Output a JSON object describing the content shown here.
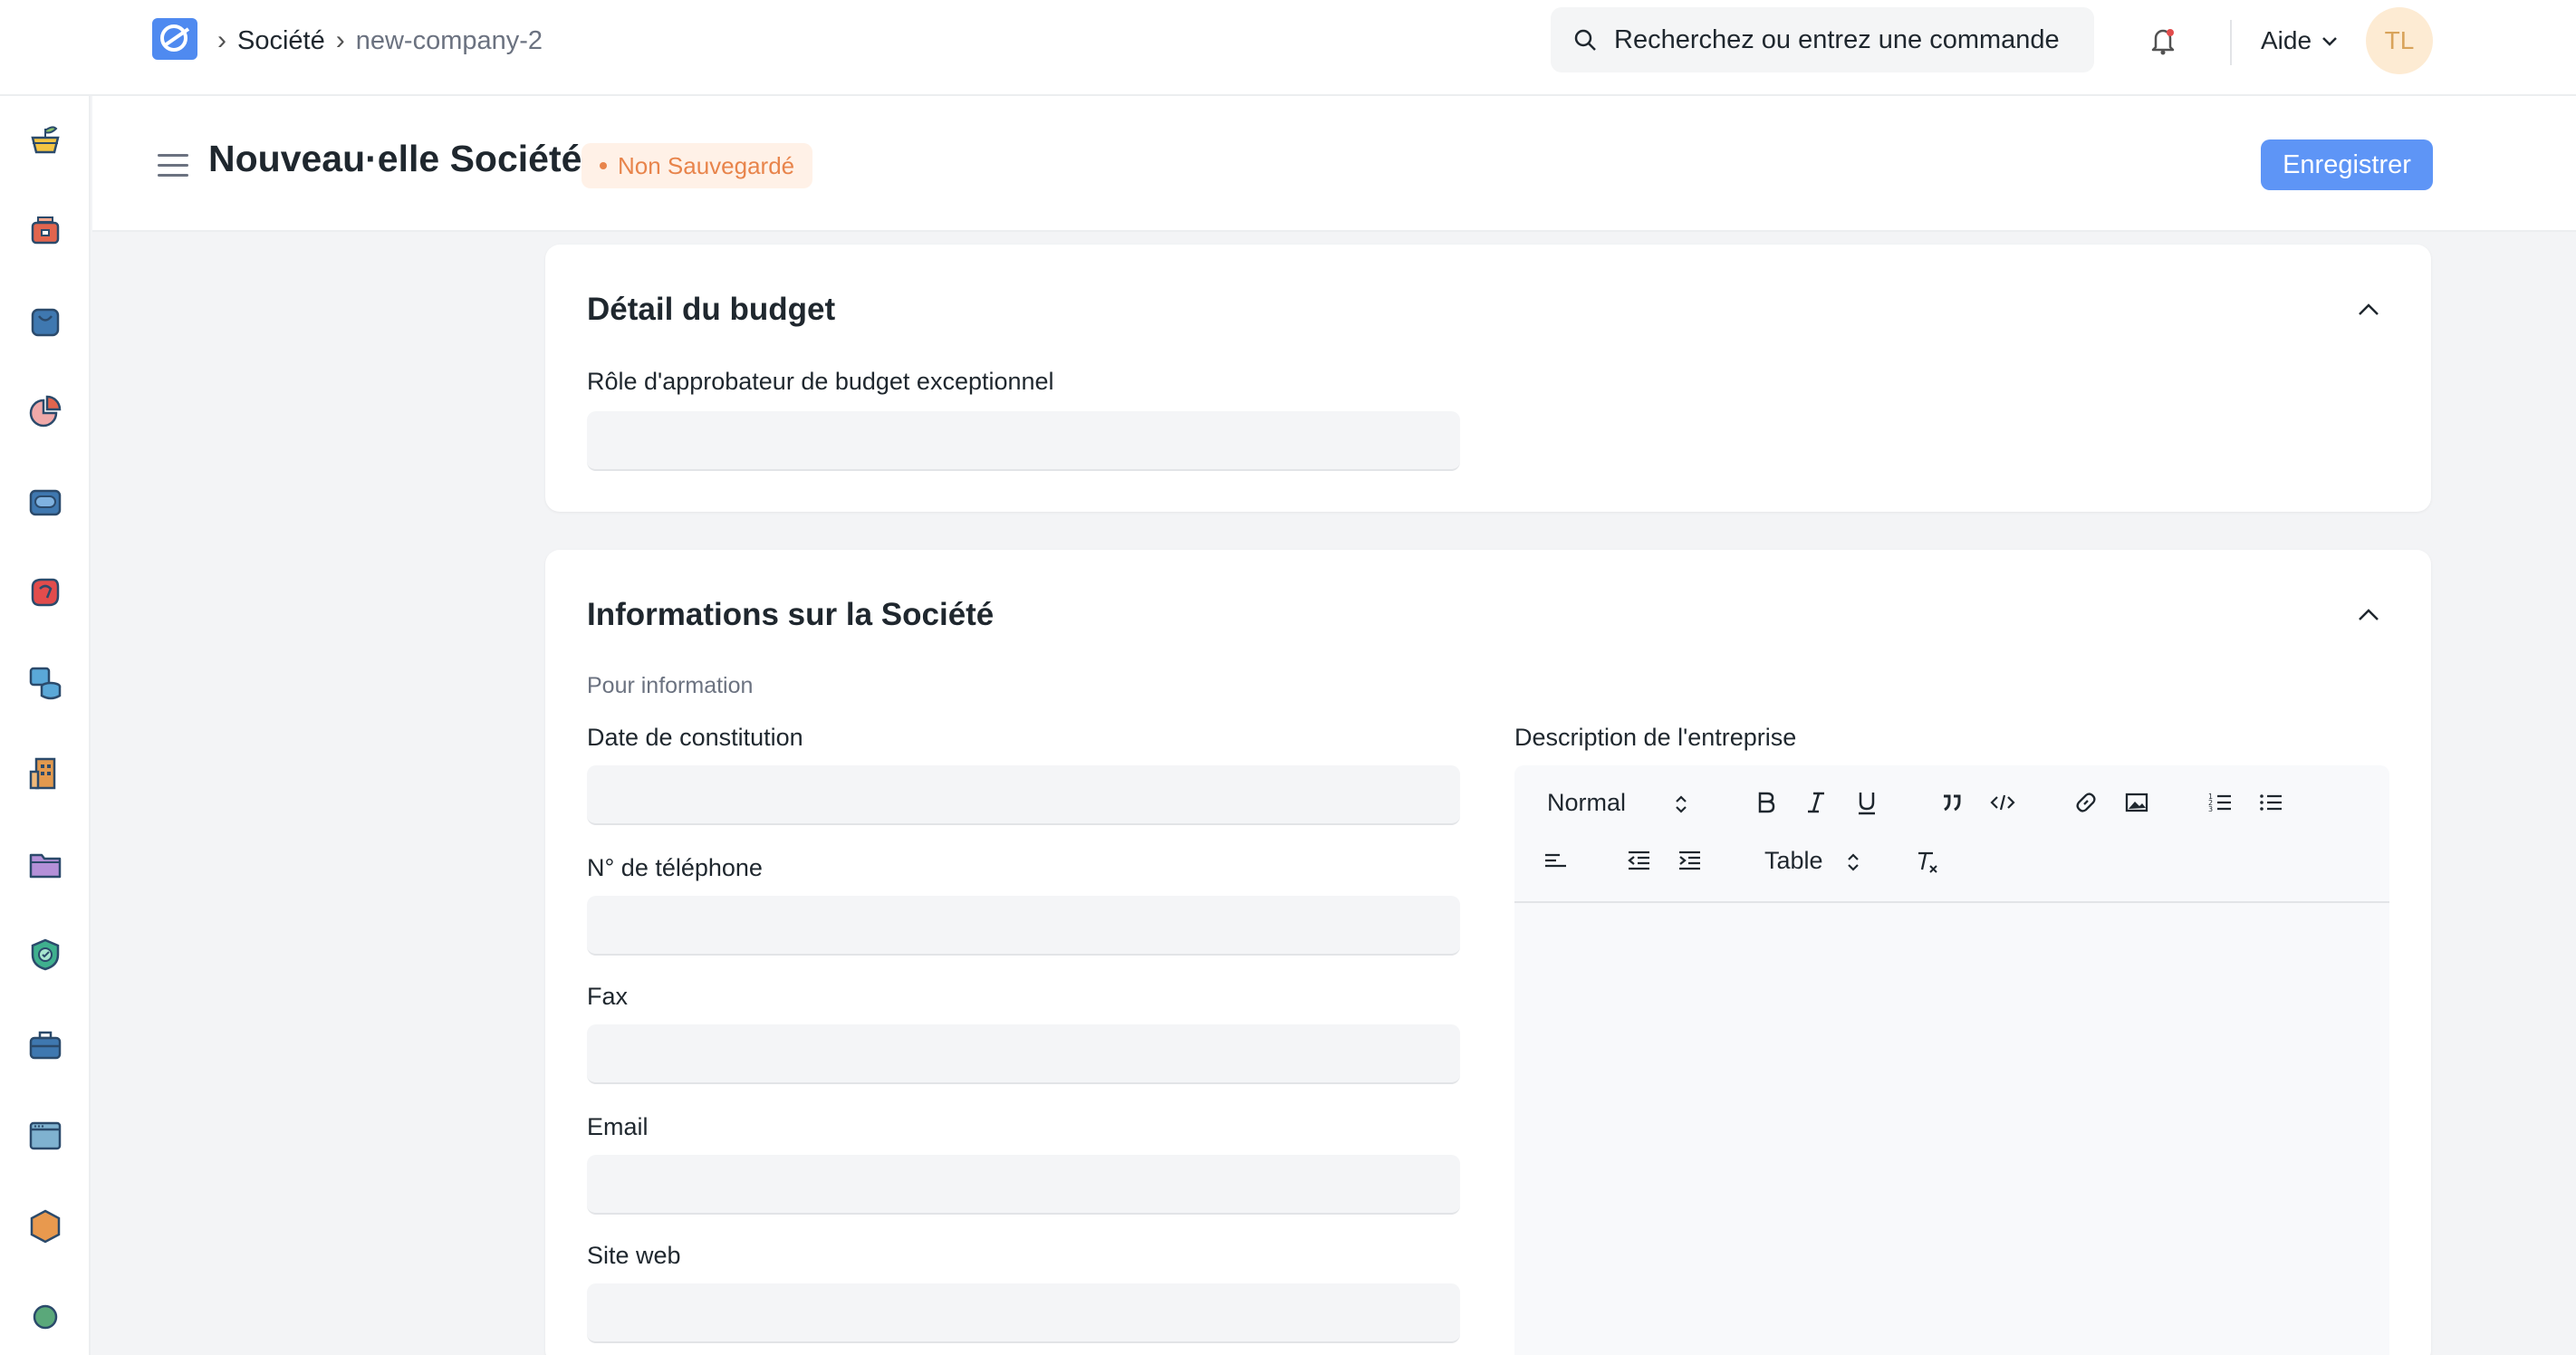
{
  "navbar": {
    "breadcrumbs": [
      "Société",
      "new-company-2"
    ],
    "search_placeholder": "Recherchez ou entrez une commande",
    "help_label": "Aide",
    "avatar_initials": "TL"
  },
  "page": {
    "title": "Nouveau·elle Société",
    "status_badge": "Non Sauvegardé",
    "save_label": "Enregistrer"
  },
  "sections": {
    "budget": {
      "title": "Détail du budget",
      "field_label": "Rôle d'approbateur de budget exceptionnel",
      "field_value": ""
    },
    "company_info": {
      "title": "Informations sur la Société",
      "subtitle": "Pour information",
      "fields": [
        {
          "label": "Date de constitution",
          "value": ""
        },
        {
          "label": "N° de téléphone",
          "value": ""
        },
        {
          "label": "Fax",
          "value": ""
        },
        {
          "label": "Email",
          "value": ""
        },
        {
          "label": "Site web",
          "value": ""
        }
      ],
      "description": {
        "label": "Description de l'entreprise",
        "text_style": "Normal",
        "table_label": "Table"
      }
    }
  },
  "sidebar_icons": [
    "seedling-icon",
    "cash-register-icon",
    "shopping-bag-icon",
    "pie-chart-icon",
    "inventory-box-icon",
    "support-icon",
    "database-icon",
    "buildings-icon",
    "folder-icon",
    "shield-check-icon",
    "briefcase-icon",
    "browser-window-icon",
    "hexagon-icon",
    "users-icon"
  ],
  "colors": {
    "accent": "#5e95f6",
    "badge_text": "#e8844b",
    "badge_bg": "#fff1e7",
    "avatar_bg": "#fdebd3"
  }
}
